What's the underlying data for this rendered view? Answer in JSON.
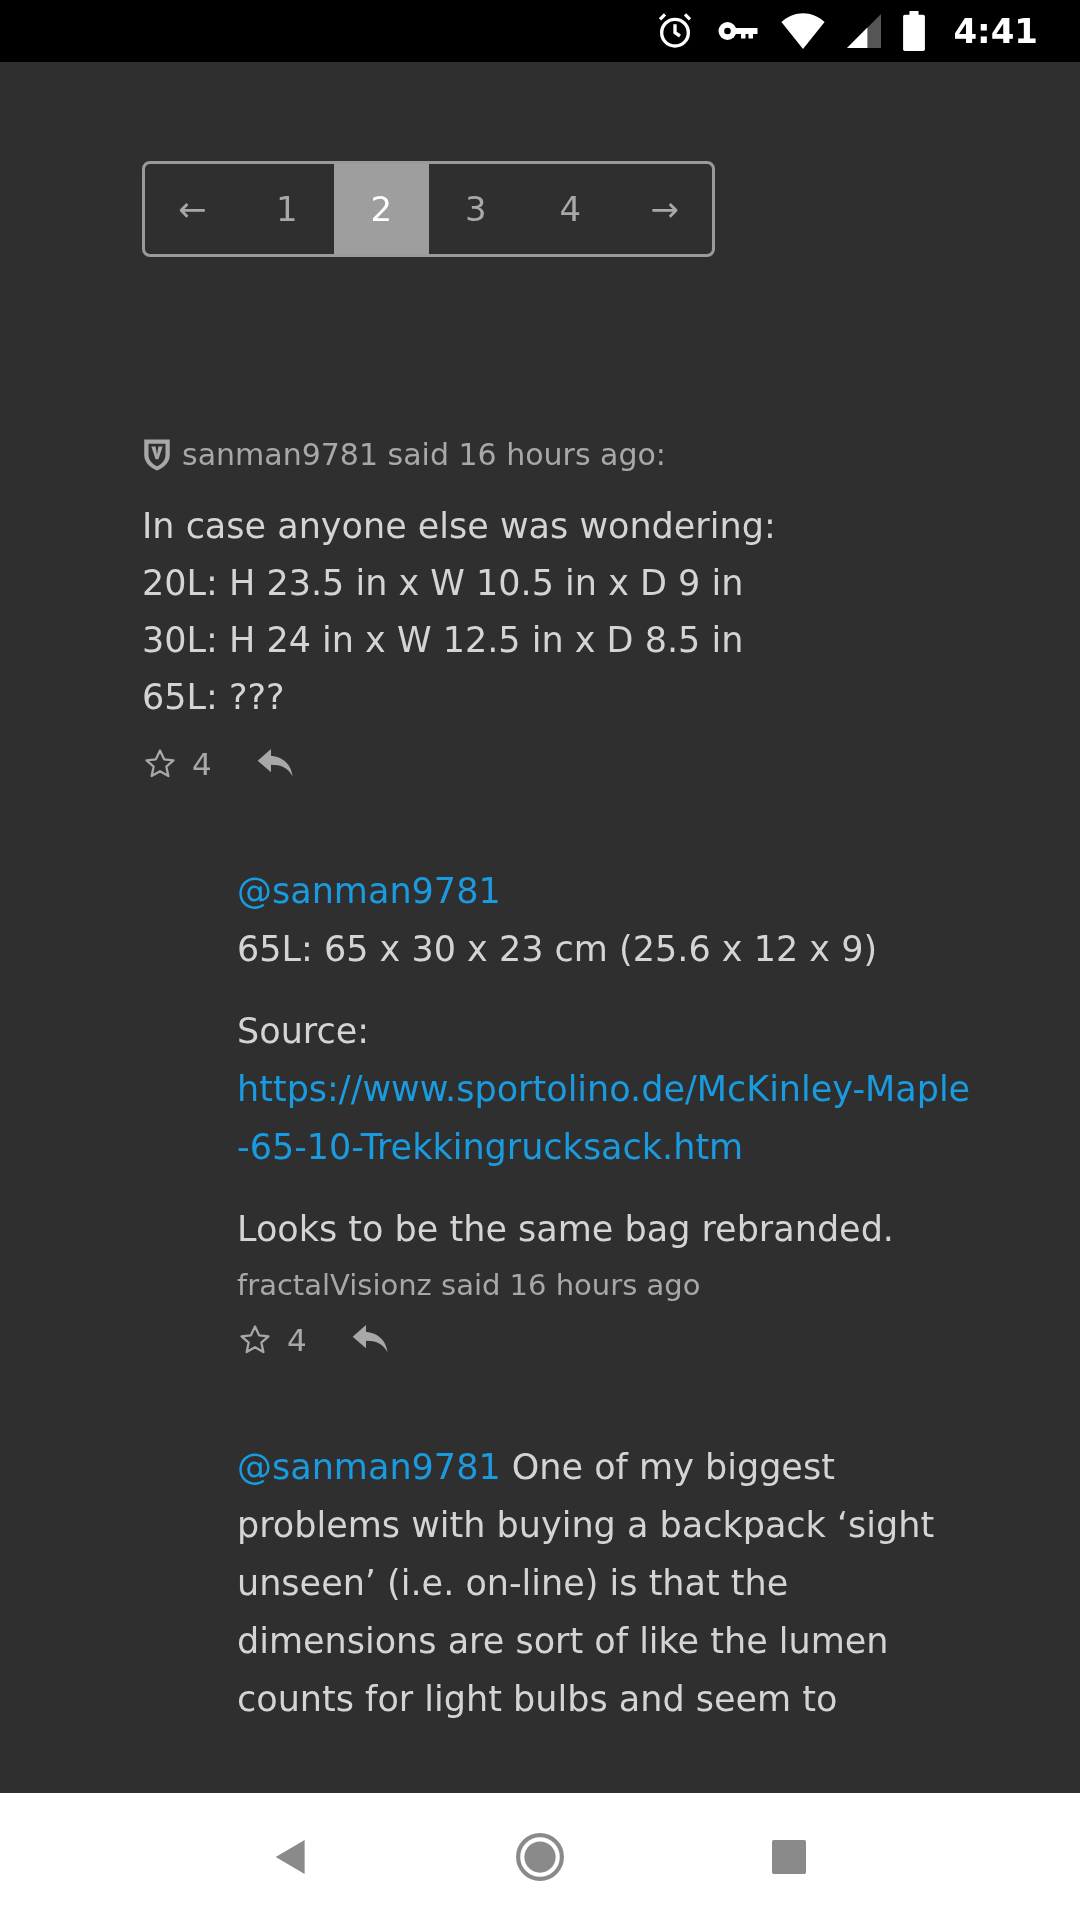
{
  "status_bar": {
    "time": "4:41"
  },
  "pagination": [
    {
      "label": "←",
      "selected": false
    },
    {
      "label": "1",
      "selected": false
    },
    {
      "label": "2",
      "selected": true
    },
    {
      "label": "3",
      "selected": false
    },
    {
      "label": "4",
      "selected": false
    },
    {
      "label": "→",
      "selected": false
    }
  ],
  "comment": {
    "header": "sanman9781 said 16 hours ago:",
    "lines": [
      "In case anyone else was wondering:",
      "20L: H 23.5 in x W 10.5 in x D 9 in",
      "30L: H 24 in x W 12.5 in x D 8.5 in",
      "65L: ???"
    ],
    "likes": "4"
  },
  "replies": [
    {
      "mention": "@sanman9781",
      "paragraphs": [
        {
          "text": "65L: 65 x 30 x 23 cm (25.6 x 12 x 9)"
        },
        {
          "text": "Source:",
          "link": "https://www.sportolino.de/McKinley-Maple-65-10-Trekkingrucksack.htm"
        },
        {
          "text": "Looks to be the same bag rebranded."
        }
      ],
      "byline": "fractalVisionz said 16 hours ago",
      "likes": "4"
    },
    {
      "mention": "@sanman9781",
      "inline_text": "One of my biggest problems with buying a backpack ‘sight unseen’ (i.e. on-line) is that the dimensions are sort of like the lumen counts for light bulbs and seem to"
    }
  ]
}
